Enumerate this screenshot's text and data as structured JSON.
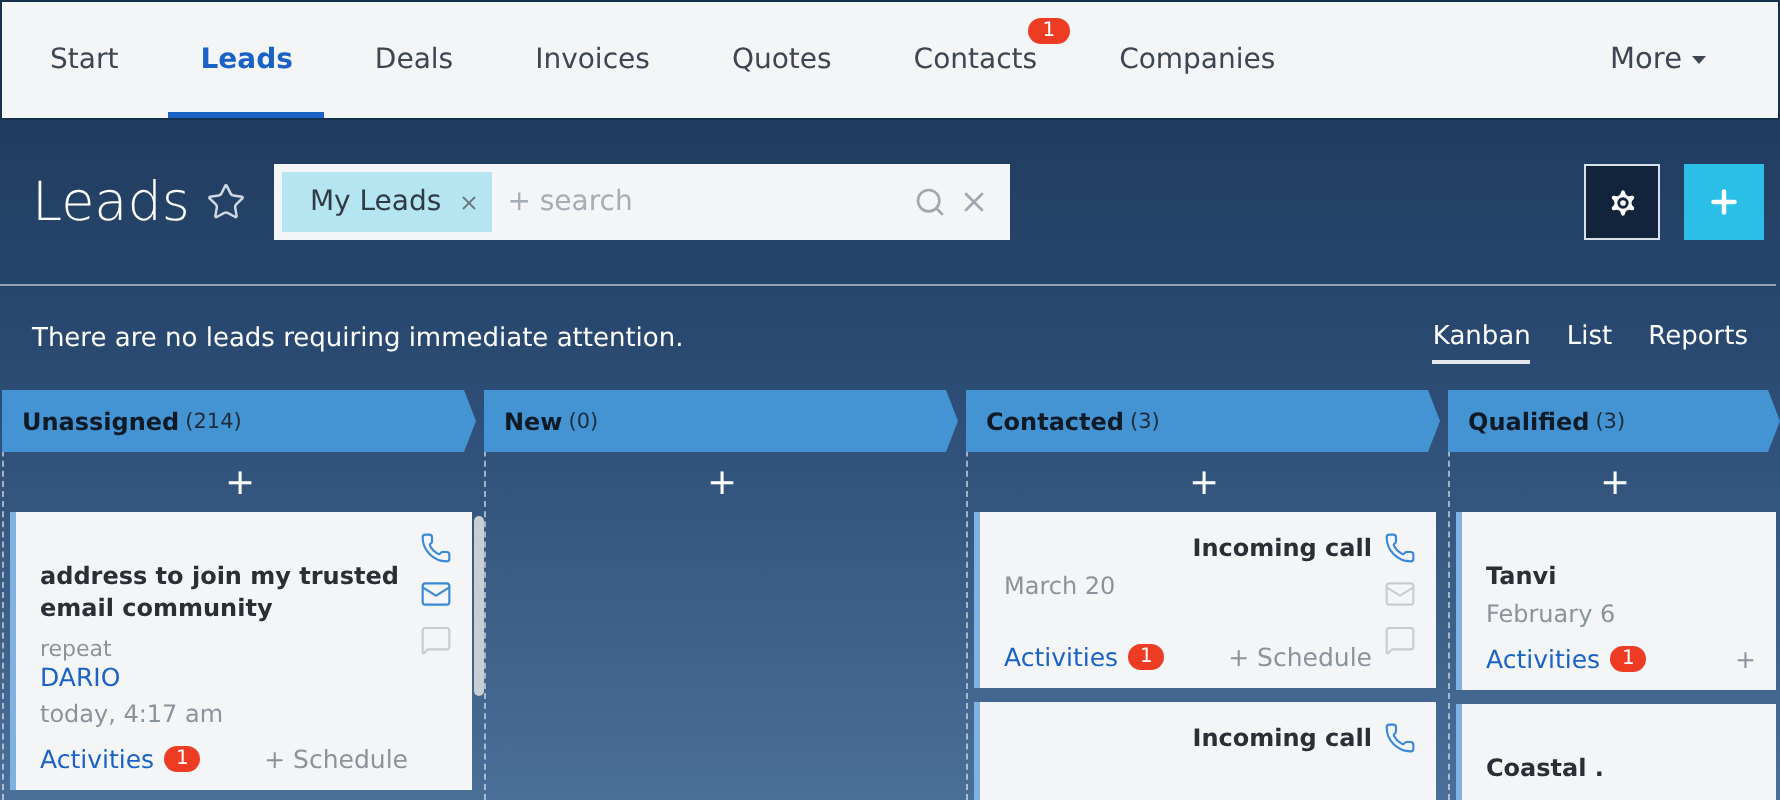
{
  "nav": {
    "items": [
      {
        "label": "Start",
        "selected": false
      },
      {
        "label": "Leads",
        "selected": true
      },
      {
        "label": "Deals",
        "selected": false
      },
      {
        "label": "Invoices",
        "selected": false
      },
      {
        "label": "Quotes",
        "selected": false
      },
      {
        "label": "Contacts",
        "selected": false,
        "badge": "1"
      },
      {
        "label": "Companies",
        "selected": false
      }
    ],
    "more": "More"
  },
  "header": {
    "title": "Leads",
    "filter_chip": "My Leads",
    "search": {
      "placeholder": "+ search"
    }
  },
  "notice": "There are no leads requiring immediate attention.",
  "views": [
    {
      "label": "Kanban",
      "selected": true
    },
    {
      "label": "List",
      "selected": false
    },
    {
      "label": "Reports",
      "selected": false
    }
  ],
  "columns": [
    {
      "name": "Unassigned",
      "count": "(214)",
      "add": "+",
      "cards": [
        {
          "kind": "lead",
          "title": "address to join my trusted email community",
          "subtitle": "repeat",
          "contact": "DARIO",
          "date": "today, 4:17 am",
          "activities": "Activities",
          "activities_count": "1",
          "schedule": "+ Schedule",
          "icons": [
            {
              "kind": "phone",
              "active": true
            },
            {
              "kind": "mail",
              "active": true
            },
            {
              "kind": "chat",
              "active": false
            }
          ]
        }
      ]
    },
    {
      "name": "New",
      "count": "(0)",
      "add": "+"
    },
    {
      "name": "Contacted",
      "count": "(3)",
      "add": "+",
      "cards": [
        {
          "kind": "call",
          "title": "Incoming call",
          "date": "March 20",
          "activities": "Activities",
          "activities_count": "1",
          "schedule": "+ Schedule",
          "icons": [
            {
              "kind": "phone",
              "active": true
            },
            {
              "kind": "mail",
              "active": false
            },
            {
              "kind": "chat",
              "active": false
            }
          ]
        },
        {
          "kind": "call",
          "title": "Incoming call",
          "icons": [
            {
              "kind": "phone",
              "active": true
            }
          ]
        }
      ]
    },
    {
      "name": "Qualified",
      "count": "(3)",
      "add": "+",
      "cards": [
        {
          "kind": "lead",
          "title": "Tanvi",
          "date": "February 6",
          "activities": "Activities",
          "activities_count": "1",
          "schedule": "+"
        },
        {
          "kind": "lead",
          "title": "Coastal ."
        }
      ]
    }
  ]
}
